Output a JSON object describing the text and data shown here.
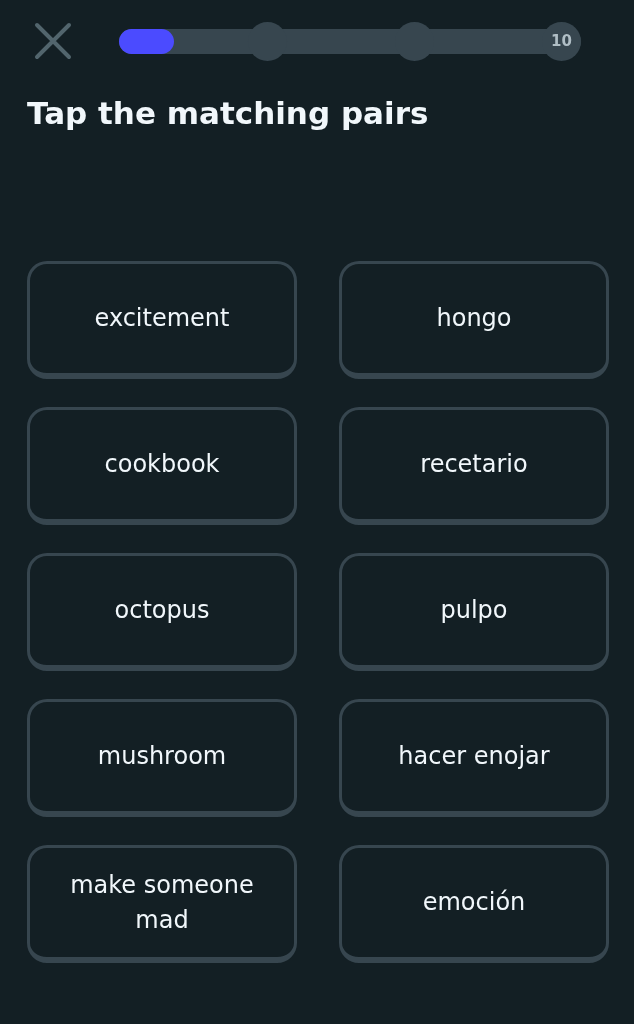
{
  "progress": {
    "level": 0.12,
    "goal_label": "10"
  },
  "title": "Tap the matching pairs",
  "pairs": [
    {
      "left": "excitement",
      "right": "hongo"
    },
    {
      "left": "cookbook",
      "right": "recetario"
    },
    {
      "left": "octopus",
      "right": "pulpo"
    },
    {
      "left": "mushroom",
      "right": "hacer enojar"
    },
    {
      "left": "make someone mad",
      "right": "emoción"
    }
  ]
}
